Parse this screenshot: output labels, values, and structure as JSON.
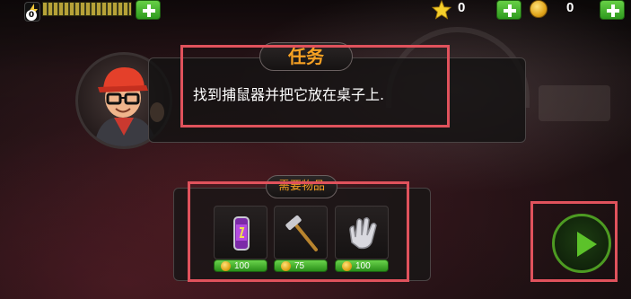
{
  "hud": {
    "energy_count": "0",
    "stars_count": "0",
    "coins_count": "0"
  },
  "mission": {
    "title": "任务",
    "text": "找到捕鼠器并把它放在桌子上."
  },
  "required_items": {
    "title": "需要物品",
    "items": [
      {
        "name": "energy-drink",
        "price": "100"
      },
      {
        "name": "hammer",
        "price": "75"
      },
      {
        "name": "glove",
        "price": "100"
      }
    ]
  },
  "colors": {
    "accent_orange": "#f6a123",
    "highlight_red": "#e0525c",
    "button_green": "#5cc22a"
  },
  "icons": [
    "energy-icon",
    "star-icon",
    "coin-icon",
    "plus-icon",
    "play-icon"
  ]
}
